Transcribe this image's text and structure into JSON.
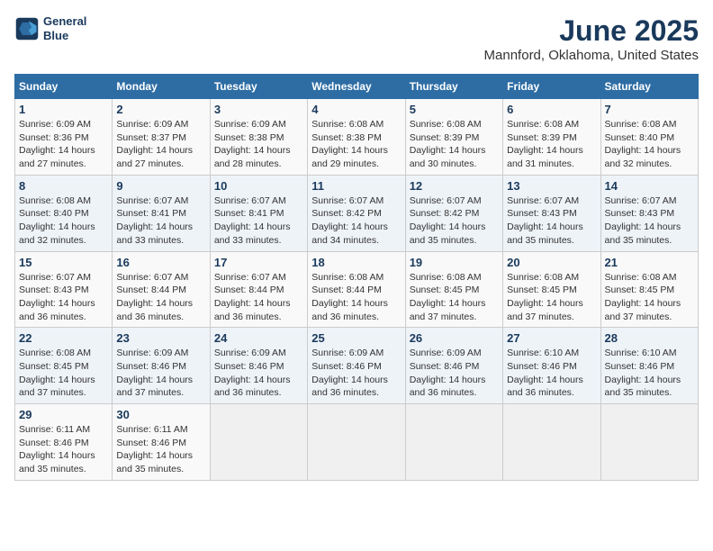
{
  "header": {
    "logo_line1": "General",
    "logo_line2": "Blue",
    "title": "June 2025",
    "subtitle": "Mannford, Oklahoma, United States"
  },
  "days_of_week": [
    "Sunday",
    "Monday",
    "Tuesday",
    "Wednesday",
    "Thursday",
    "Friday",
    "Saturday"
  ],
  "weeks": [
    [
      {
        "day": "1",
        "info": "Sunrise: 6:09 AM\nSunset: 8:36 PM\nDaylight: 14 hours\nand 27 minutes."
      },
      {
        "day": "2",
        "info": "Sunrise: 6:09 AM\nSunset: 8:37 PM\nDaylight: 14 hours\nand 27 minutes."
      },
      {
        "day": "3",
        "info": "Sunrise: 6:09 AM\nSunset: 8:38 PM\nDaylight: 14 hours\nand 28 minutes."
      },
      {
        "day": "4",
        "info": "Sunrise: 6:08 AM\nSunset: 8:38 PM\nDaylight: 14 hours\nand 29 minutes."
      },
      {
        "day": "5",
        "info": "Sunrise: 6:08 AM\nSunset: 8:39 PM\nDaylight: 14 hours\nand 30 minutes."
      },
      {
        "day": "6",
        "info": "Sunrise: 6:08 AM\nSunset: 8:39 PM\nDaylight: 14 hours\nand 31 minutes."
      },
      {
        "day": "7",
        "info": "Sunrise: 6:08 AM\nSunset: 8:40 PM\nDaylight: 14 hours\nand 32 minutes."
      }
    ],
    [
      {
        "day": "8",
        "info": "Sunrise: 6:08 AM\nSunset: 8:40 PM\nDaylight: 14 hours\nand 32 minutes."
      },
      {
        "day": "9",
        "info": "Sunrise: 6:07 AM\nSunset: 8:41 PM\nDaylight: 14 hours\nand 33 minutes."
      },
      {
        "day": "10",
        "info": "Sunrise: 6:07 AM\nSunset: 8:41 PM\nDaylight: 14 hours\nand 33 minutes."
      },
      {
        "day": "11",
        "info": "Sunrise: 6:07 AM\nSunset: 8:42 PM\nDaylight: 14 hours\nand 34 minutes."
      },
      {
        "day": "12",
        "info": "Sunrise: 6:07 AM\nSunset: 8:42 PM\nDaylight: 14 hours\nand 35 minutes."
      },
      {
        "day": "13",
        "info": "Sunrise: 6:07 AM\nSunset: 8:43 PM\nDaylight: 14 hours\nand 35 minutes."
      },
      {
        "day": "14",
        "info": "Sunrise: 6:07 AM\nSunset: 8:43 PM\nDaylight: 14 hours\nand 35 minutes."
      }
    ],
    [
      {
        "day": "15",
        "info": "Sunrise: 6:07 AM\nSunset: 8:43 PM\nDaylight: 14 hours\nand 36 minutes."
      },
      {
        "day": "16",
        "info": "Sunrise: 6:07 AM\nSunset: 8:44 PM\nDaylight: 14 hours\nand 36 minutes."
      },
      {
        "day": "17",
        "info": "Sunrise: 6:07 AM\nSunset: 8:44 PM\nDaylight: 14 hours\nand 36 minutes."
      },
      {
        "day": "18",
        "info": "Sunrise: 6:08 AM\nSunset: 8:44 PM\nDaylight: 14 hours\nand 36 minutes."
      },
      {
        "day": "19",
        "info": "Sunrise: 6:08 AM\nSunset: 8:45 PM\nDaylight: 14 hours\nand 37 minutes."
      },
      {
        "day": "20",
        "info": "Sunrise: 6:08 AM\nSunset: 8:45 PM\nDaylight: 14 hours\nand 37 minutes."
      },
      {
        "day": "21",
        "info": "Sunrise: 6:08 AM\nSunset: 8:45 PM\nDaylight: 14 hours\nand 37 minutes."
      }
    ],
    [
      {
        "day": "22",
        "info": "Sunrise: 6:08 AM\nSunset: 8:45 PM\nDaylight: 14 hours\nand 37 minutes."
      },
      {
        "day": "23",
        "info": "Sunrise: 6:09 AM\nSunset: 8:46 PM\nDaylight: 14 hours\nand 37 minutes."
      },
      {
        "day": "24",
        "info": "Sunrise: 6:09 AM\nSunset: 8:46 PM\nDaylight: 14 hours\nand 36 minutes."
      },
      {
        "day": "25",
        "info": "Sunrise: 6:09 AM\nSunset: 8:46 PM\nDaylight: 14 hours\nand 36 minutes."
      },
      {
        "day": "26",
        "info": "Sunrise: 6:09 AM\nSunset: 8:46 PM\nDaylight: 14 hours\nand 36 minutes."
      },
      {
        "day": "27",
        "info": "Sunrise: 6:10 AM\nSunset: 8:46 PM\nDaylight: 14 hours\nand 36 minutes."
      },
      {
        "day": "28",
        "info": "Sunrise: 6:10 AM\nSunset: 8:46 PM\nDaylight: 14 hours\nand 35 minutes."
      }
    ],
    [
      {
        "day": "29",
        "info": "Sunrise: 6:11 AM\nSunset: 8:46 PM\nDaylight: 14 hours\nand 35 minutes."
      },
      {
        "day": "30",
        "info": "Sunrise: 6:11 AM\nSunset: 8:46 PM\nDaylight: 14 hours\nand 35 minutes."
      },
      {
        "day": "",
        "info": ""
      },
      {
        "day": "",
        "info": ""
      },
      {
        "day": "",
        "info": ""
      },
      {
        "day": "",
        "info": ""
      },
      {
        "day": "",
        "info": ""
      }
    ]
  ]
}
